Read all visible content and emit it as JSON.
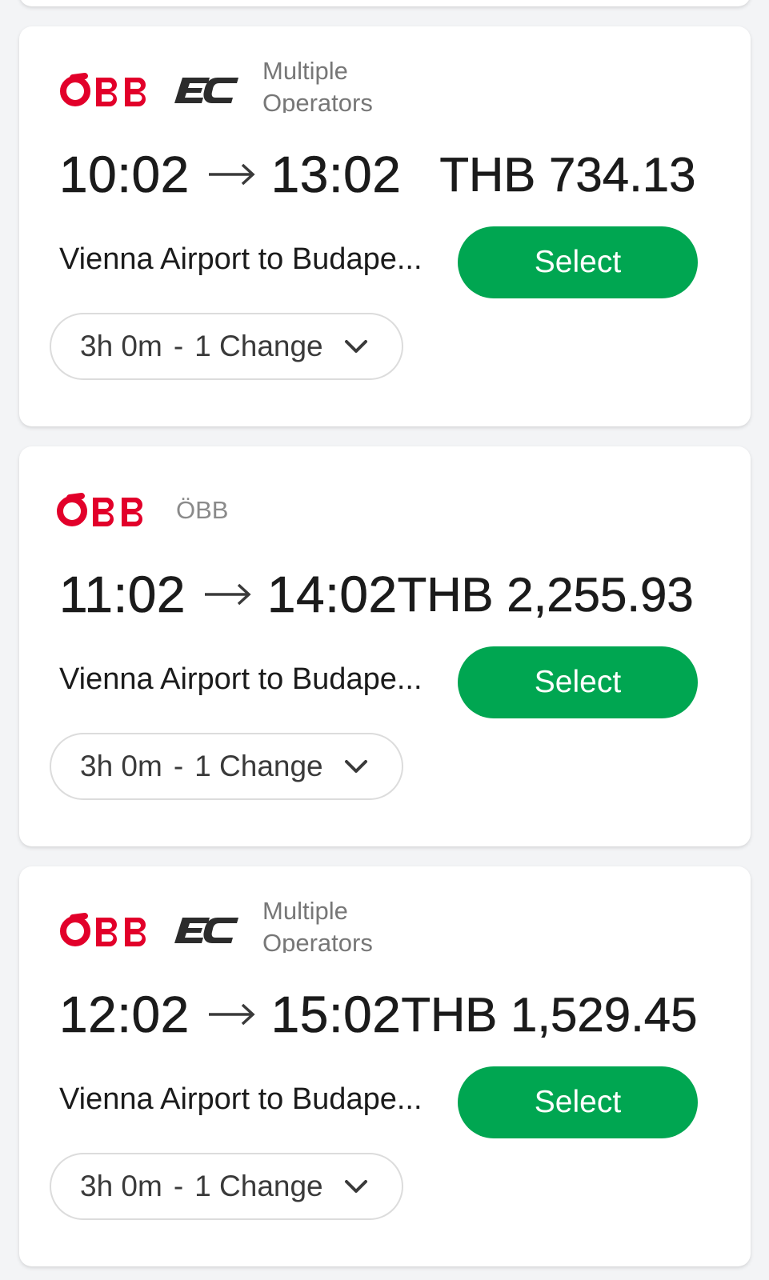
{
  "colors": {
    "accent_green": "#00a651",
    "obb_red": "#e2002a",
    "text_primary": "#1b1b1b",
    "text_secondary": "#777777"
  },
  "results": [
    {
      "logos": [
        "obb-logo",
        "ec-logo"
      ],
      "operator": "Multiple Operators",
      "depart": "10:02",
      "arrive": "13:02",
      "price": "THB 734.13",
      "route": "Vienna Airport to Budape...",
      "select_label": "Select",
      "duration": "3h 0m",
      "separator": "-",
      "changes": "1 Change"
    },
    {
      "logos": [
        "obb-logo"
      ],
      "operator": "ÖBB",
      "depart": "11:02",
      "arrive": "14:02",
      "price": "THB 2,255.93",
      "route": "Vienna Airport to Budape...",
      "select_label": "Select",
      "duration": "3h 0m",
      "separator": "-",
      "changes": "1 Change"
    },
    {
      "logos": [
        "obb-logo",
        "ec-logo"
      ],
      "operator": "Multiple Operators",
      "depart": "12:02",
      "arrive": "15:02",
      "price": "THB 1,529.45",
      "route": "Vienna Airport to Budape...",
      "select_label": "Select",
      "duration": "3h 0m",
      "separator": "-",
      "changes": "1 Change"
    }
  ]
}
